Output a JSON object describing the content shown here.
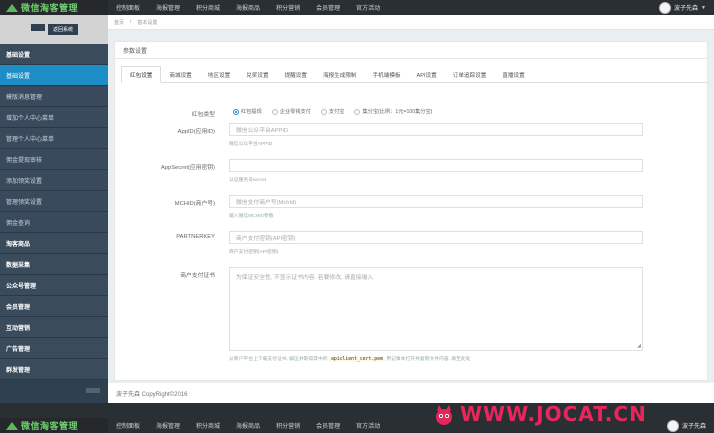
{
  "app": {
    "title": "微信淘客管理"
  },
  "topnav": [
    "控制面板",
    "海报管理",
    "积分商城",
    "海报商品",
    "积分营销",
    "会员管理",
    "官方活动"
  ],
  "user": {
    "name": "波子先森"
  },
  "sidebar": {
    "button": "返回系统",
    "items": [
      {
        "label": "基础设置",
        "kind": "group"
      },
      {
        "label": "基础设置",
        "kind": "active"
      },
      {
        "label": "模版消息管理",
        "kind": "sub"
      },
      {
        "label": "增加个人中心菜单",
        "kind": "sub"
      },
      {
        "label": "管理个人中心菜单",
        "kind": "sub"
      },
      {
        "label": "佣金提现审核",
        "kind": "sub"
      },
      {
        "label": "添加领奖设置",
        "kind": "sub"
      },
      {
        "label": "管理领奖设置",
        "kind": "sub"
      },
      {
        "label": "佣金查询",
        "kind": "sub"
      },
      {
        "label": "淘客商品",
        "kind": "group"
      },
      {
        "label": "数据采集",
        "kind": "group"
      },
      {
        "label": "公众号管理",
        "kind": "group"
      },
      {
        "label": "会员管理",
        "kind": "group"
      },
      {
        "label": "互动营销",
        "kind": "group"
      },
      {
        "label": "广告管理",
        "kind": "group"
      },
      {
        "label": "群发管理",
        "kind": "group"
      }
    ]
  },
  "breadcrumb": {
    "home": "首页",
    "sep": "/",
    "current": "基本设置"
  },
  "panel": {
    "title": "参数设置"
  },
  "tabs": [
    "红包设置",
    "商城设置",
    "地区设置",
    "兑奖设置",
    "提醒设置",
    "海报生成限制",
    "手机端模板",
    "API设置",
    "订单追踪设置",
    "直播设置"
  ],
  "form": {
    "redpack_label": "红包类型",
    "radio_options": [
      "红包提现",
      "企业零钱支付",
      "支付宝",
      "集分宝(比例：1元=100集分宝)"
    ],
    "selected_radio": 0,
    "appid": {
      "label": "AppID(应用ID)",
      "placeholder": "微信公众平台APPID",
      "help": "微信公众平台APPID"
    },
    "appsecret": {
      "label": "AppSecret(应用密钥)",
      "placeholder": "",
      "help": "认证服务号secret"
    },
    "mchid": {
      "label": "MCHID(商户号)",
      "placeholder": "微信支付商户号(MchId)",
      "help": "输入微信MCHID参数"
    },
    "partnerkey": {
      "label": "PARTNERKEY",
      "placeholder": "商户支付密钥(API密钥)",
      "help": "商户支付密钥(API密钥)"
    },
    "cert": {
      "label": "商户支付证书",
      "placeholder": "为保证安全性, 不显示证书内容. 若要修改, 请直接输入",
      "help_pre": "从商户平台上下载支付证书, 解压并取得其中的",
      "help_code": "apiclient_cert.pem",
      "help_post": "用记事本打开并复制文件内容, 填至此处"
    }
  },
  "footer": {
    "copyright": "波子先森 CopyRight©2016"
  },
  "watermark": "WWW.JOCAT.CN",
  "colors": {
    "accent": "#1c84c6",
    "sidebar": "#2f4050",
    "topbar": "#2a2f33",
    "logo": "#6fcf6f"
  }
}
